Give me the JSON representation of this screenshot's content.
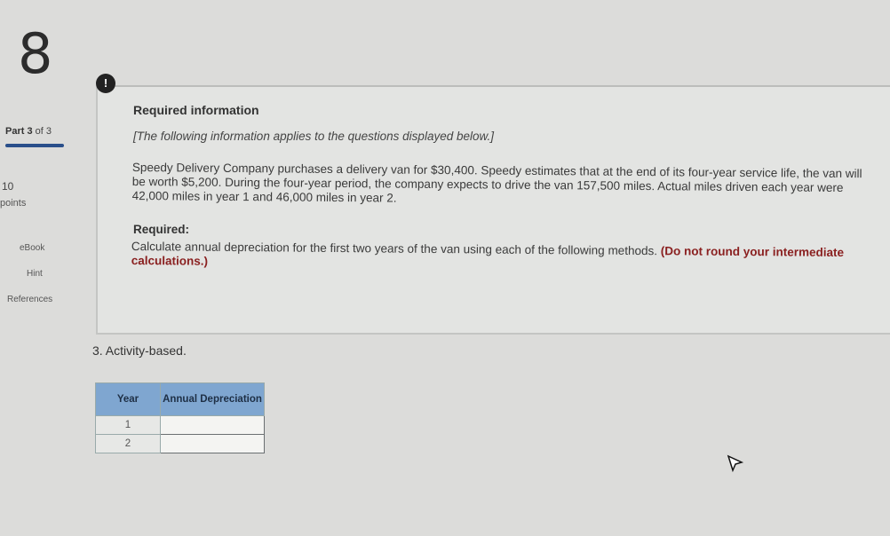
{
  "sidebar": {
    "question_number": "8",
    "part_label": "Part",
    "part_value": "3",
    "part_suffix": "of 3",
    "points_value": "10",
    "points_label": "points",
    "links": [
      "eBook",
      "Hint",
      "References"
    ]
  },
  "alert_icon": "!",
  "info": {
    "title": "Required information",
    "note": "[The following information applies to the questions displayed below.]",
    "paragraph": "Speedy Delivery Company purchases a delivery van for $30,400. Speedy estimates that at the end of its four-year service life, the van will be worth $5,200. During the four-year period, the company expects to drive the van 157,500 miles. Actual miles driven each year were 42,000 miles in year 1 and 46,000 miles in year 2.",
    "required_title": "Required:",
    "required_text": "Calculate annual depreciation for the first two years of the van using each of the following methods.",
    "required_emphasis": "(Do not round your intermediate calculations.)"
  },
  "question": {
    "label": "3. Activity-based.",
    "table": {
      "headers": [
        "Year",
        "Annual Depreciation"
      ],
      "rows": [
        {
          "year": "1",
          "annual_depreciation": ""
        },
        {
          "year": "2",
          "annual_depreciation": ""
        }
      ]
    }
  },
  "colors": {
    "table_header": "#7fa6d0",
    "progress_bar": "#2a4f8a",
    "emphasis": "#8a2020"
  },
  "icons": [
    "alert-icon",
    "mouse-cursor-icon"
  ]
}
